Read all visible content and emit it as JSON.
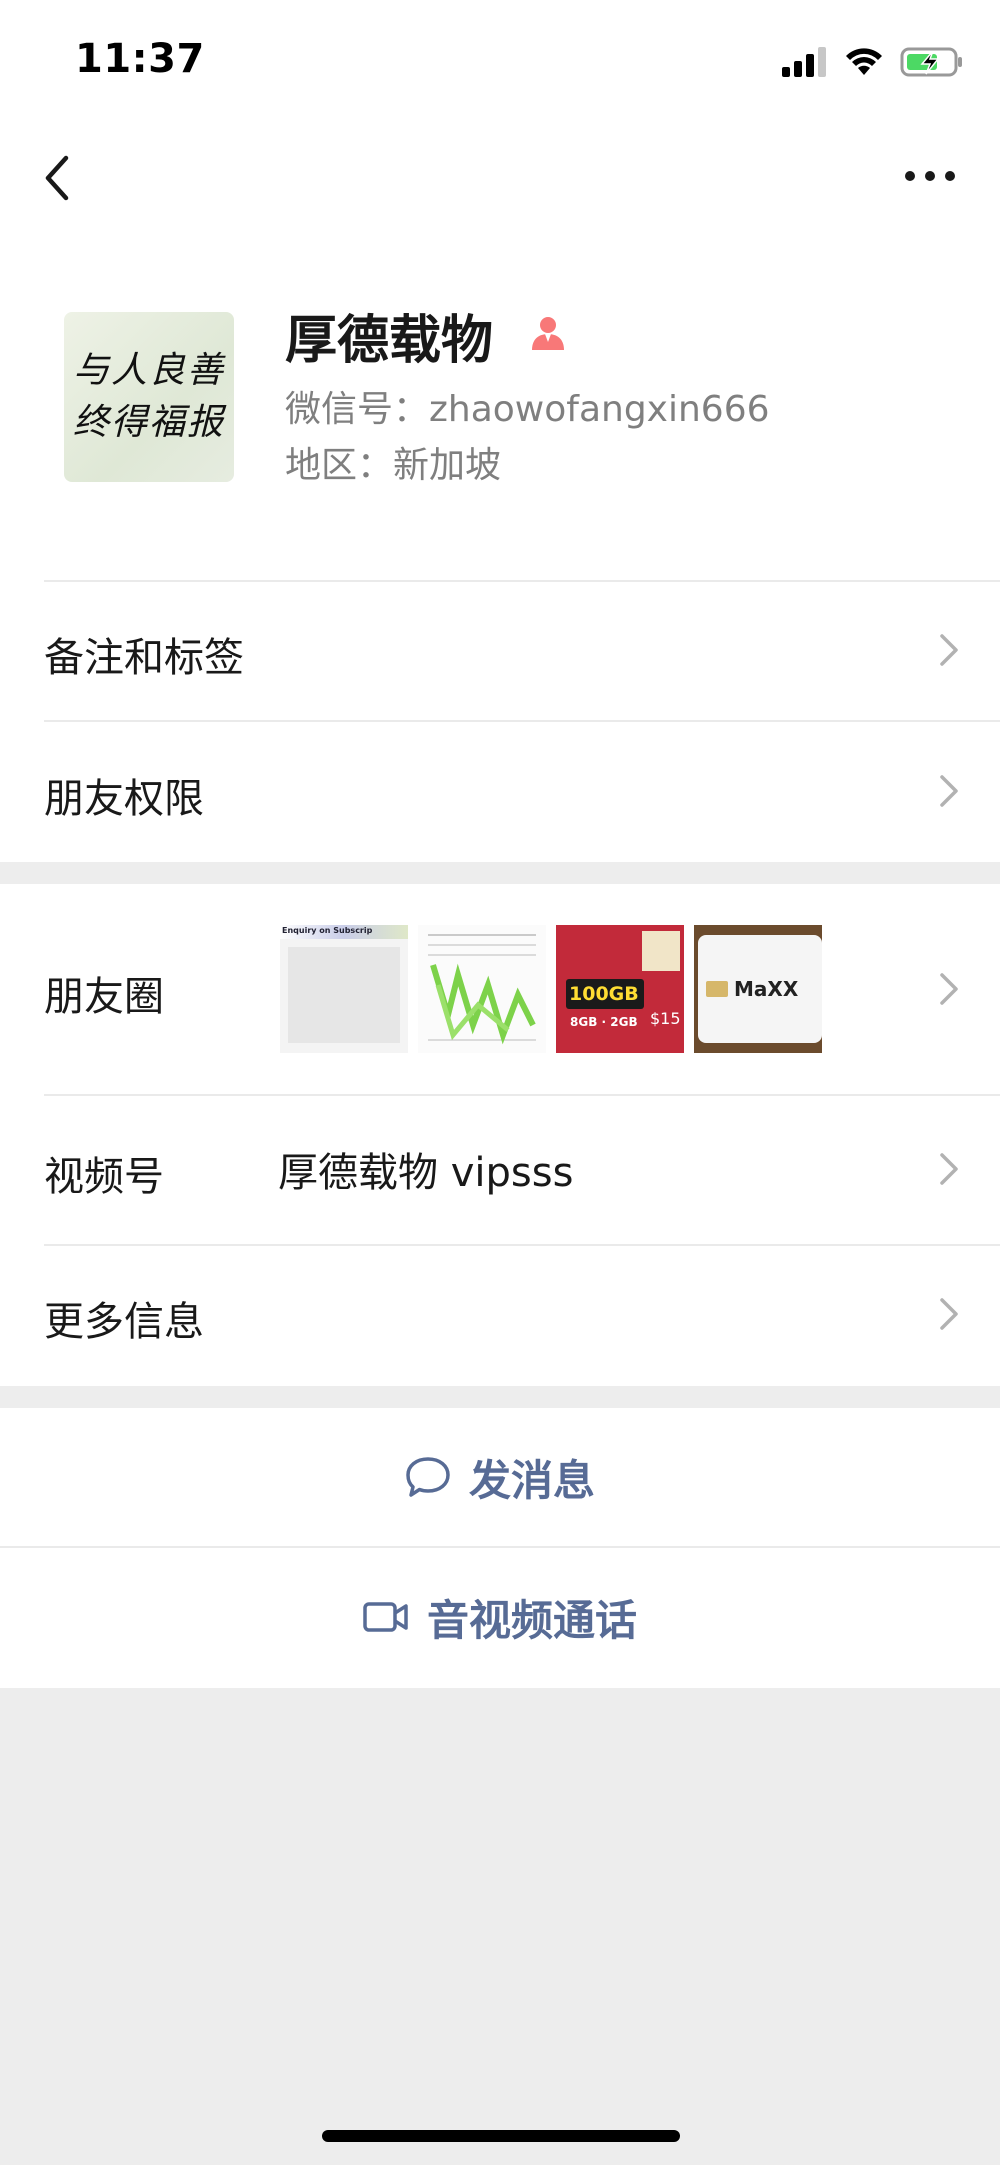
{
  "status_bar": {
    "time": "11:37"
  },
  "profile": {
    "name": "厚德载物",
    "wechat_id": "微信号：zhaowofangxin666",
    "region": "地区：新加坡",
    "avatar_text_line1": "与人良善",
    "avatar_text_line2": "终得福报"
  },
  "rows": {
    "notes_tags": "备注和标签",
    "friend_permissions": "朋友权限",
    "moments": "朋友圈",
    "channels": "视频号",
    "channels_value": "厚德载物 vipsss",
    "more_info": "更多信息"
  },
  "moments_thumbs": {
    "thumb1_title": "Enquiry on Subscrip",
    "thumb3_text": "100GB",
    "thumb3_sub": "8GB · 2GB",
    "thumb3_price": "$15",
    "thumb4_text": "MaXX"
  },
  "actions": {
    "send_message": "发消息",
    "video_call": "音视频通话"
  },
  "colors": {
    "link_blue": "#576b95",
    "background": "#ededed",
    "profile_icon": "#f87878"
  }
}
